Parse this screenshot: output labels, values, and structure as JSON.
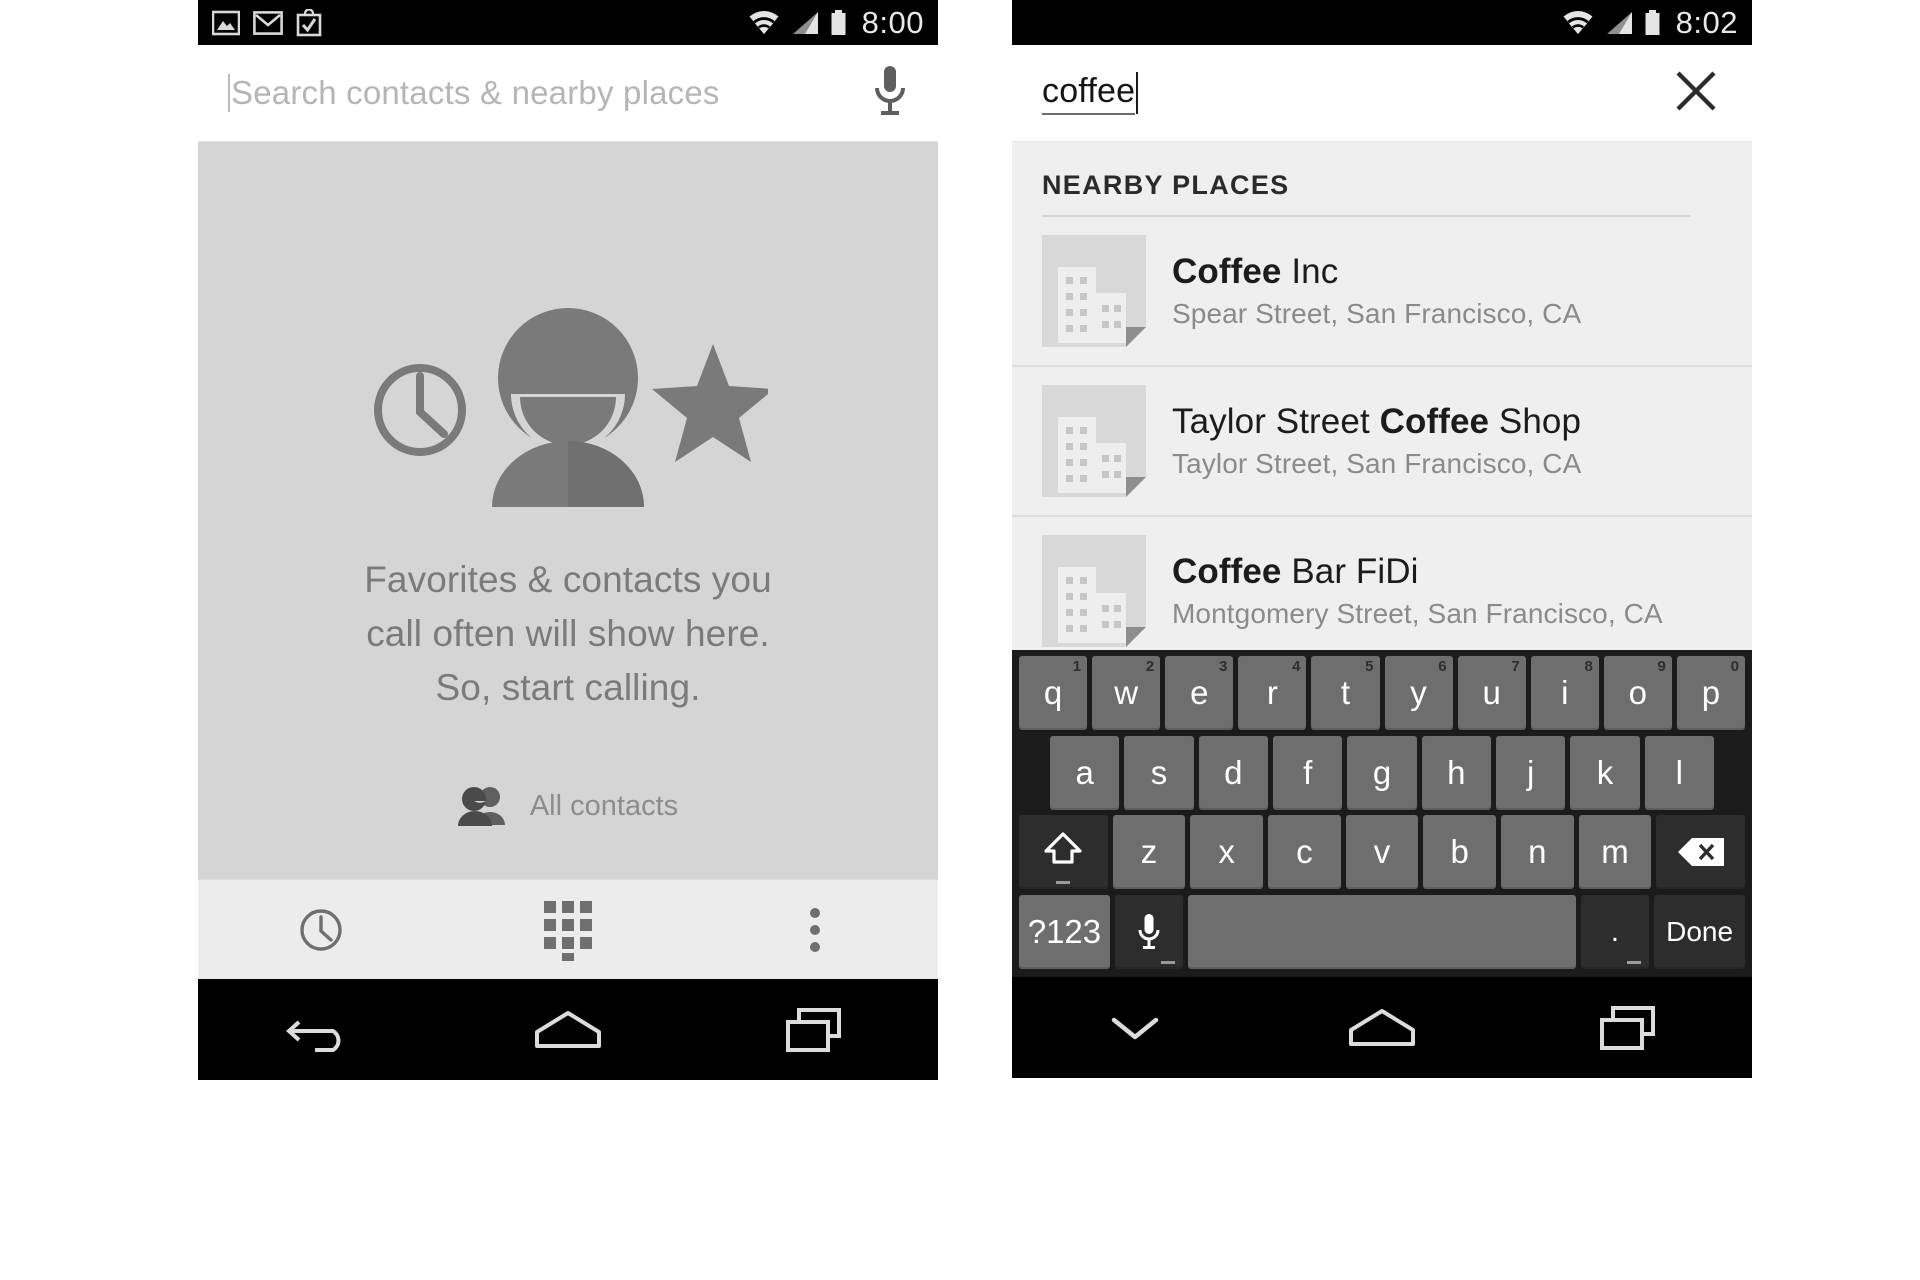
{
  "left_phone": {
    "statusbar": {
      "time": "8:00",
      "icons": [
        "image-icon",
        "gmail-icon",
        "checkbox-bag-icon",
        "wifi-icon",
        "cell-signal-icon",
        "battery-icon"
      ]
    },
    "search": {
      "placeholder": "Search contacts & nearby places",
      "value": "",
      "mic_icon": "microphone-icon"
    },
    "empty_state": {
      "illustration_icons": [
        "clock-icon",
        "person-avatar-icon",
        "star-icon"
      ],
      "line1": "Favorites & contacts you",
      "line2": "call often will show here.",
      "line3": "So, start calling.",
      "all_contacts_label": "All contacts",
      "all_contacts_icon": "people-icon"
    },
    "tabbar": {
      "items": [
        {
          "name": "recents-tab",
          "icon": "clock-icon"
        },
        {
          "name": "dialpad-tab",
          "icon": "dialpad-icon"
        },
        {
          "name": "overflow-menu",
          "icon": "more-vertical-icon"
        }
      ]
    },
    "navbar": {
      "items": [
        {
          "name": "back-button",
          "icon": "back-arrow-icon"
        },
        {
          "name": "home-button",
          "icon": "home-icon"
        },
        {
          "name": "recents-button",
          "icon": "recents-icon"
        }
      ]
    }
  },
  "right_phone": {
    "statusbar": {
      "time": "8:02",
      "icons": [
        "wifi-icon",
        "cell-signal-icon",
        "battery-icon"
      ]
    },
    "search": {
      "value": "coffee",
      "clear_icon": "close-x-icon"
    },
    "results": {
      "header": "NEARBY PLACES",
      "items": [
        {
          "name_prefix": "",
          "name_match": "Coffee",
          "name_suffix": " Inc",
          "address": "Spear Street, San Francisco, CA",
          "thumb_icon": "building-thumbnail-icon"
        },
        {
          "name_prefix": "Taylor Street ",
          "name_match": "Coffee",
          "name_suffix": " Shop",
          "address": "Taylor Street, San Francisco, CA",
          "thumb_icon": "building-thumbnail-icon"
        },
        {
          "name_prefix": "",
          "name_match": "Coffee",
          "name_suffix": " Bar FiDi",
          "address": "Montgomery Street, San Francisco, CA",
          "thumb_icon": "building-thumbnail-icon"
        }
      ]
    },
    "keyboard": {
      "row1": [
        {
          "key": "q",
          "num": "1"
        },
        {
          "key": "w",
          "num": "2"
        },
        {
          "key": "e",
          "num": "3"
        },
        {
          "key": "r",
          "num": "4"
        },
        {
          "key": "t",
          "num": "5"
        },
        {
          "key": "y",
          "num": "6"
        },
        {
          "key": "u",
          "num": "7"
        },
        {
          "key": "i",
          "num": "8"
        },
        {
          "key": "o",
          "num": "9"
        },
        {
          "key": "p",
          "num": "0"
        }
      ],
      "row2": [
        {
          "key": "a"
        },
        {
          "key": "s"
        },
        {
          "key": "d"
        },
        {
          "key": "f"
        },
        {
          "key": "g"
        },
        {
          "key": "h"
        },
        {
          "key": "j"
        },
        {
          "key": "k"
        },
        {
          "key": "l"
        }
      ],
      "row3": [
        {
          "key": "z"
        },
        {
          "key": "x"
        },
        {
          "key": "c"
        },
        {
          "key": "v"
        },
        {
          "key": "b"
        },
        {
          "key": "n"
        },
        {
          "key": "m"
        }
      ],
      "shift_icon": "shift-arrow-icon",
      "backspace_icon": "backspace-icon",
      "symbols_label": "?123",
      "mic_icon": "microphone-icon",
      "space_label": "",
      "period_label": ".",
      "done_label": "Done"
    },
    "navbar": {
      "items": [
        {
          "name": "hide-keyboard-button",
          "icon": "chevron-down-icon"
        },
        {
          "name": "home-button",
          "icon": "home-icon"
        },
        {
          "name": "recents-button",
          "icon": "recents-icon"
        }
      ]
    }
  },
  "colors": {
    "status_bg": "#000000",
    "empty_bg": "#d5d5d5",
    "tabbar_bg": "#ececec",
    "results_bg": "#efefef",
    "keyboard_bg": "#1b1b1b",
    "key_bg": "#6e6e6e",
    "key_dark_bg": "#2d2d2d",
    "muted_text": "#8b8b8b",
    "primary_text": "#1c1c1c"
  }
}
